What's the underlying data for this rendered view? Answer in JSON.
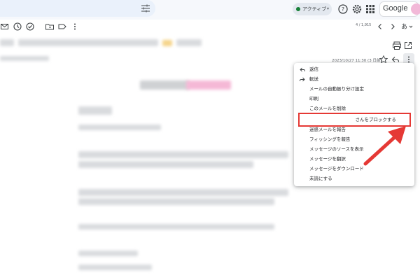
{
  "topbar": {
    "status_label": "アクティブ",
    "google_label": "Google",
    "icons": [
      "tune-icon",
      "help-icon",
      "settings-icon",
      "apps-icon"
    ]
  },
  "toolbar": {
    "icons": [
      "mail-icon",
      "snooze-icon",
      "add-task-icon",
      "move-to-icon",
      "label-icon",
      "more-vert-icon"
    ],
    "counter": "4 / 1,915"
  },
  "mail": {
    "timestamp": "2023/10/27 11:30 (3 日前)",
    "header_icons": [
      "print-icon",
      "open-in-new-icon",
      "star-icon",
      "reply-icon",
      "more-vert-icon"
    ]
  },
  "menu": {
    "items": [
      {
        "label": "返信",
        "icon": "reply-icon"
      },
      {
        "label": "転送",
        "icon": "forward-icon"
      },
      {
        "label": "メールの自動振り分け設定",
        "icon": ""
      },
      {
        "label": "印刷",
        "icon": ""
      },
      {
        "label": "このメールを削除",
        "icon": ""
      },
      {
        "label": "さんをブロックする",
        "icon": ""
      },
      {
        "label": "迷惑メールを報告",
        "icon": ""
      },
      {
        "label": "フィッシングを報告",
        "icon": ""
      },
      {
        "label": "メッセージのソースを表示",
        "icon": ""
      },
      {
        "label": "メッセージを翻訳",
        "icon": ""
      },
      {
        "label": "メッセージをダウンロード",
        "icon": ""
      },
      {
        "label": "未読にする",
        "icon": ""
      }
    ]
  },
  "colors": {
    "highlight": "#e53935",
    "status_dot": "#188038",
    "accent_pink": "#f2b8d8"
  }
}
